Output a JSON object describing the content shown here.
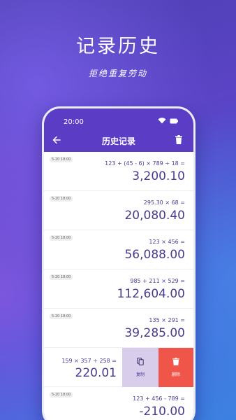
{
  "promo": {
    "title": "记录历史",
    "subtitle": "拒绝重复劳动"
  },
  "status_bar": {
    "time": "20:00"
  },
  "header": {
    "title": "历史记录"
  },
  "history": [
    {
      "time": "5-20 18:00",
      "expression": "123 + (45 - 6) × 789 ÷ 18 =",
      "result": "3,200.10"
    },
    {
      "time": "5-20 18:00",
      "expression": "295.30 × 68 =",
      "result": "20,080.40"
    },
    {
      "time": "5-20 18:00",
      "expression": "123 × 456 =",
      "result": "56,088.00"
    },
    {
      "time": "5-20 18:00",
      "expression": "985 + 211 × 529 =",
      "result": "112,604.00"
    },
    {
      "time": "5-20 18:00",
      "expression": "135 × 291 =",
      "result": "39,285.00"
    },
    {
      "time": "",
      "expression": "159 × 357 ÷ 258 =",
      "result": "220.01"
    },
    {
      "time": "5-20 18:00",
      "expression": "123 + 456 - 789 =",
      "result": "-210.00"
    }
  ],
  "actions": {
    "copy": "复制",
    "delete": "删除"
  },
  "colors": {
    "accent": "#5b3cc4",
    "delete": "#f0554a",
    "copy_bg": "#d8cdea"
  }
}
